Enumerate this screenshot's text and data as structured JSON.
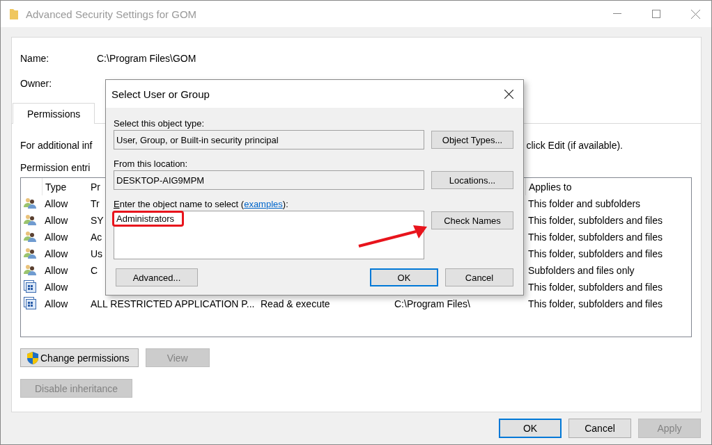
{
  "window": {
    "title": "Advanced Security Settings for GOM"
  },
  "fields": [
    {
      "label": "Name:",
      "value": "C:\\Program Files\\GOM"
    },
    {
      "label": "Owner:"
    }
  ],
  "tabs": [
    {
      "label": "Permissions",
      "selected": true
    }
  ],
  "info_left": "For additional inf",
  "info_right": "click Edit (if available).",
  "entries_label": "Permission entri",
  "table": {
    "columns": {
      "type": "Type",
      "principal": "Pr",
      "applies_to": "Applies to"
    },
    "rows": [
      {
        "kind": "user",
        "type": "Allow",
        "principal": "Tr",
        "applies_to": "This folder and subfolders"
      },
      {
        "kind": "user",
        "type": "Allow",
        "principal": "SY",
        "applies_to": "This folder, subfolders and files"
      },
      {
        "kind": "user",
        "type": "Allow",
        "principal": "Ac",
        "applies_to": "This folder, subfolders and files"
      },
      {
        "kind": "user",
        "type": "Allow",
        "principal": "Us",
        "applies_to": "This folder, subfolders and files"
      },
      {
        "kind": "user",
        "type": "Allow",
        "principal": "C",
        "applies_to": "Subfolders and files only"
      },
      {
        "kind": "app",
        "type": "Allow",
        "applies_to": "This folder, subfolders and files"
      },
      {
        "kind": "app",
        "type": "Allow",
        "principal": "ALL RESTRICTED APPLICATION P...",
        "access": "Read & execute",
        "inherited_from": "C:\\Program Files\\",
        "applies_to": "This folder, subfolders and files"
      }
    ]
  },
  "actions": [
    {
      "kind": "shield",
      "label": "Change permissions",
      "disabled": false
    },
    {
      "kind": "plain",
      "label": "View",
      "disabled": true
    },
    {
      "kind": "plain",
      "label": "Disable inheritance",
      "disabled": true
    }
  ],
  "footer": [
    {
      "label": "OK",
      "default": true,
      "disabled": false
    },
    {
      "label": "Cancel",
      "default": false,
      "disabled": false
    },
    {
      "label": "Apply",
      "default": false,
      "disabled": true
    }
  ],
  "dialog": {
    "title": "Select User or Group",
    "object_type": {
      "label": "Select this object type:",
      "value": "User, Group, or Built-in security principal",
      "button": "Object Types..."
    },
    "location": {
      "label": "From this location:",
      "value": "DESKTOP-AIG9MPM",
      "button": "Locations..."
    },
    "name_entry": {
      "label_start": "Enter the object name to select (",
      "link": "examples",
      "label_end": "):",
      "value": "Administrators",
      "button": "Check Names"
    },
    "advanced": "Advanced...",
    "buttons": [
      {
        "label": "OK",
        "default": true
      },
      {
        "label": "Cancel",
        "default": false
      }
    ]
  },
  "annotations": {
    "highlight_box": true,
    "arrow": true
  }
}
